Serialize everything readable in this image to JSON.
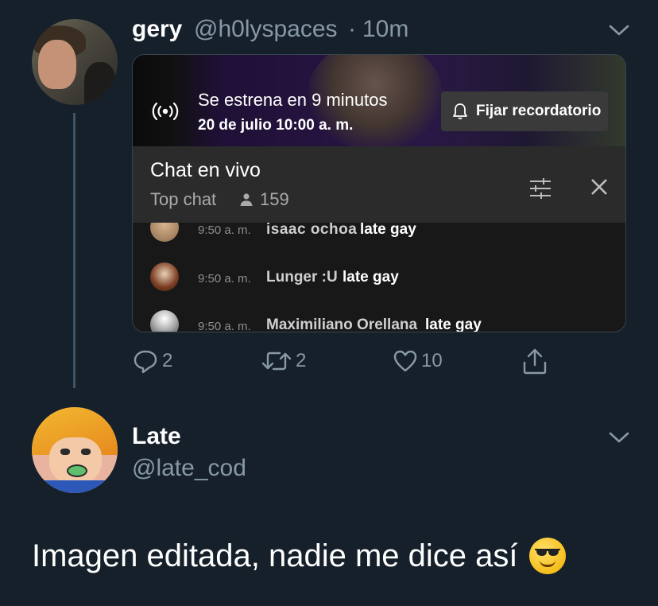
{
  "tweet1": {
    "author_name": "gery",
    "author_handle": "@h0lyspaces",
    "separator": "·",
    "time": "10m",
    "card": {
      "premiere_text": "Se estrena en 9 minutos",
      "premiere_date": "20 de julio 10:00 a. m.",
      "reminder_label": "Fijar recordatorio",
      "chat_title": "Chat en vivo",
      "chat_mode": "Top chat",
      "viewer_count": "159",
      "messages": [
        {
          "time": "9:50 a. m.",
          "author": "isaac ochoa",
          "text": "late gay"
        },
        {
          "time": "9:50 a. m.",
          "author": "Lunger :U",
          "text": "late gay"
        },
        {
          "time": "9:50 a. m.",
          "author": "Maximiliano Orellana",
          "text": "late gay"
        }
      ]
    },
    "actions": {
      "reply_count": "2",
      "retweet_count": "2",
      "like_count": "10"
    }
  },
  "tweet2": {
    "author_name": "Late",
    "author_handle": "@late_cod",
    "text": "Imagen editada, nadie me dice así",
    "emoji": "smiling-face-with-sunglasses-icon"
  },
  "colors": {
    "background": "#15202b",
    "secondary_text": "#8899a6",
    "thread_line": "#3d5466"
  }
}
